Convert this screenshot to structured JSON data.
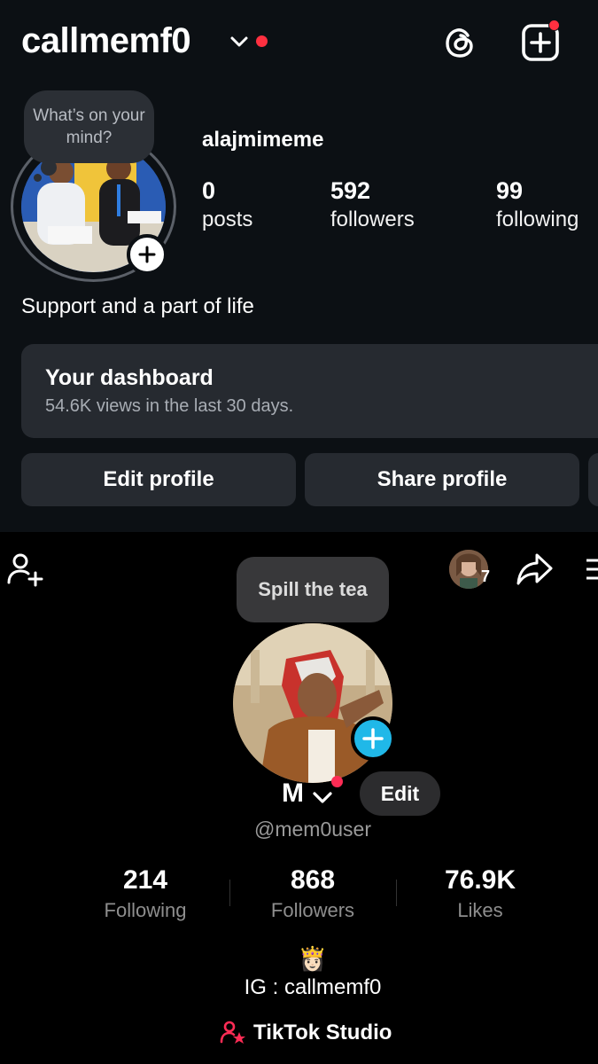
{
  "instagram": {
    "username": "callmemf0",
    "note": "What’s on your mind?",
    "display_name": "alajmimeme",
    "stats": [
      {
        "value": "0",
        "label": "posts"
      },
      {
        "value": "592",
        "label": "followers"
      },
      {
        "value": "99",
        "label": "following"
      }
    ],
    "bio": "Support and a part of life",
    "dashboard": {
      "title": "Your dashboard",
      "subtitle": "54.6K views in the last 30 days."
    },
    "buttons": {
      "edit": "Edit profile",
      "share": "Share profile"
    },
    "icons": [
      "chevron-down-icon",
      "threads-icon",
      "create-post-icon",
      "add-story-icon"
    ],
    "accent_color": "#ff3040"
  },
  "tiktok": {
    "note": "Spill the tea",
    "friend_count": "7",
    "name": "M",
    "edit_label": "Edit",
    "handle": "@mem0user",
    "stats": [
      {
        "value": "214",
        "label": "Following"
      },
      {
        "value": "868",
        "label": "Followers"
      },
      {
        "value": "76.9K",
        "label": "Likes"
      }
    ],
    "bio_emoji": "👸🏻",
    "bio_line": "IG : callmemf0",
    "studio_label": "TikTok Studio",
    "icons": [
      "add-user-icon",
      "share-icon",
      "menu-icon",
      "plus-icon",
      "tiktok-studio-icon"
    ],
    "accent_color": "#fe2c55",
    "add_button_color": "#20b8e8"
  }
}
